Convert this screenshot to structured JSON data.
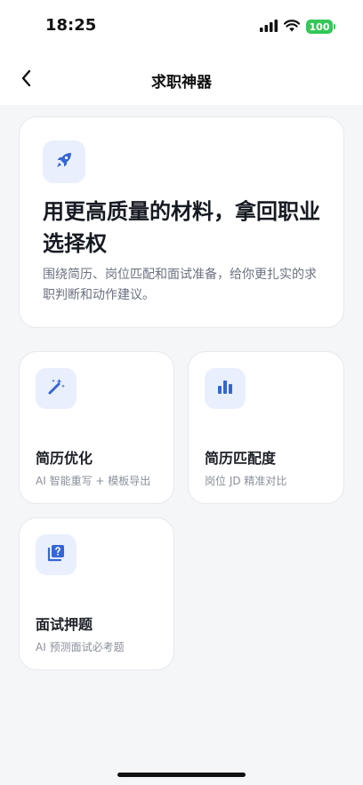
{
  "status_bar": {
    "time": "18:25",
    "battery": "100",
    "icons": [
      "signal-icon",
      "wifi-icon",
      "battery-icon"
    ]
  },
  "nav": {
    "title": "求职神器",
    "back_icon": "chevron-left-icon"
  },
  "hero": {
    "icon": "rocket-icon",
    "title": "用更高质量的材料，拿回职业选择权",
    "description": "围绕简历、岗位匹配和面试准备，给你更扎实的求职判断和动作建议。"
  },
  "features": [
    {
      "icon": "magic-wand-icon",
      "title": "简历优化",
      "subtitle": "AI 智能重写 + 模板导出"
    },
    {
      "icon": "bar-chart-icon",
      "title": "简历匹配度",
      "subtitle": "岗位 JD 精准对比"
    },
    {
      "icon": "question-book-icon",
      "title": "面试押题",
      "subtitle": "AI 预测面试必考题"
    }
  ],
  "colors": {
    "accent": "#3566d6",
    "icon_tile_bg": "#e9effd",
    "page_bg": "#f5f6f8",
    "battery": "#34c759"
  }
}
